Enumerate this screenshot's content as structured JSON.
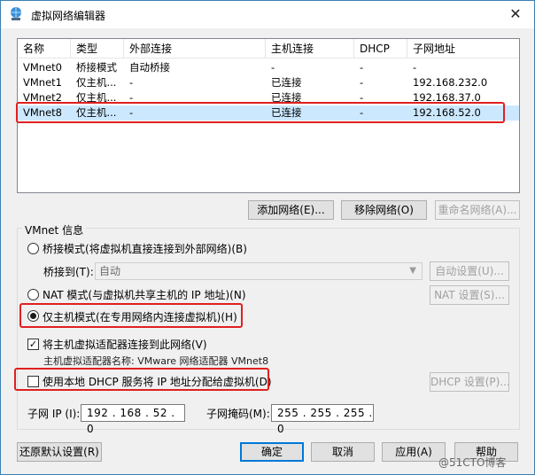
{
  "window": {
    "title": "虚拟网络编辑器",
    "close": "✕"
  },
  "list": {
    "columns": [
      "名称",
      "类型",
      "外部连接",
      "主机连接",
      "DHCP",
      "子网地址"
    ],
    "rows": [
      [
        "VMnet0",
        "桥接模式",
        "自动桥接",
        "-",
        "-",
        "-"
      ],
      [
        "VMnet1",
        "仅主机...",
        "-",
        "已连接",
        "-",
        "192.168.232.0"
      ],
      [
        "VMnet2",
        "仅主机...",
        "-",
        "已连接",
        "-",
        "192.168.37.0"
      ],
      [
        "VMnet8",
        "仅主机...",
        "-",
        "已连接",
        "-",
        "192.168.52.0"
      ]
    ],
    "selected_index": 3
  },
  "list_buttons": {
    "add": "添加网络(E)...",
    "remove": "移除网络(O)",
    "rename": "重命名网络(A)..."
  },
  "vmnet_info": {
    "label": "VMnet 信息",
    "bridge_radio": "桥接模式(将虚拟机直接连接到外部网络)(B)",
    "bridge_to_label": "桥接到(T):",
    "bridge_to_value": "自动",
    "auto_settings": "自动设置(U)...",
    "nat_radio": "NAT 模式(与虚拟机共享主机的 IP 地址)(N)",
    "nat_settings": "NAT 设置(S)...",
    "hostonly_radio": "仅主机模式(在专用网络内连接虚拟机)(H)",
    "selected_mode": "hostonly",
    "connect_adapter": "将主机虚拟适配器连接到此网络(V)",
    "connect_adapter_checked": true,
    "adapter_name": "主机虚拟适配器名称: VMware 网络适配器 VMnet8",
    "use_dhcp": "使用本地 DHCP 服务将 IP 地址分配给虚拟机(D)",
    "use_dhcp_checked": false,
    "dhcp_settings": "DHCP 设置(P)...",
    "subnet_ip_label": "子网 IP (I):",
    "subnet_ip": "192 . 168 . 52 . 0",
    "subnet_mask_label": "子网掩码(M):",
    "subnet_mask": "255 . 255 . 255 . 0"
  },
  "footer": {
    "restore": "还原默认设置(R)",
    "ok": "确定",
    "cancel": "取消",
    "apply": "应用(A)",
    "help": "帮助"
  },
  "watermark": "@51CTO博客",
  "colors": {
    "highlight": "#e02020",
    "selection": "#cce8ff"
  }
}
